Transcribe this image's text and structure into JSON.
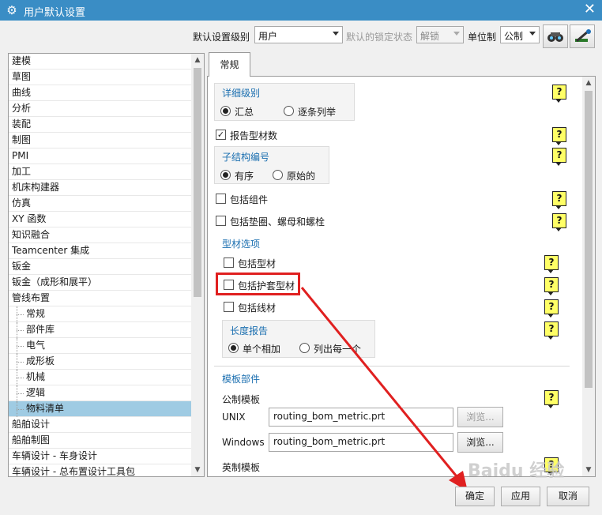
{
  "window": {
    "title": "用户默认设置",
    "close": "✕",
    "icon": "gear-icon"
  },
  "toolbar": {
    "level_label": "默认设置级别",
    "level_value": "用户",
    "lock_label": "默认的锁定状态",
    "lock_value": "解锁",
    "unit_label": "单位制",
    "unit_value": "公制"
  },
  "tree": [
    "建模",
    "草图",
    "曲线",
    "分析",
    "装配",
    "制图",
    "PMI",
    "加工",
    "机床构建器",
    "仿真",
    "XY 函数",
    "知识融合",
    "Teamcenter 集成",
    "钣金",
    "钣金（成形和展平）",
    "管线布置"
  ],
  "tree_children": [
    "常规",
    "部件库",
    "电气",
    "成形板",
    "机械",
    "逻辑",
    "物料清单"
  ],
  "tree_after": [
    "船舶设计",
    "船舶制图",
    "车辆设计 - 车身设计",
    "车辆设计 - 总布置设计工具包"
  ],
  "tab": {
    "label": "常规"
  },
  "content": {
    "detail_group": {
      "title": "详细级别",
      "opt1": "汇总",
      "opt2": "逐条列举"
    },
    "report_profile": "报告型材数",
    "sub_group": {
      "title": "子结构编号",
      "opt1": "有序",
      "opt2": "原始的"
    },
    "include_component": "包括组件",
    "include_washer": "包括垫圈、螺母和螺栓",
    "profile_options": "型材选项",
    "include_profile": "包括型材",
    "include_sleeve": "包括护套型材",
    "include_wire": "包括线材",
    "length_group": {
      "title": "长度报告",
      "opt1": "单个相加",
      "opt2": "列出每一个"
    },
    "template_section": "模板部件",
    "metric_template": "公制模板",
    "unix_label": "UNIX",
    "unix_value": "routing_bom_metric.prt",
    "browse1": "浏览...",
    "windows_label": "Windows",
    "windows_value": "routing_bom_metric.prt",
    "browse2": "浏览...",
    "english_template": "英制模板",
    "help": "?"
  },
  "buttons": {
    "ok": "确定",
    "apply": "应用",
    "cancel": "取消"
  },
  "watermark": "Baidu 经验"
}
